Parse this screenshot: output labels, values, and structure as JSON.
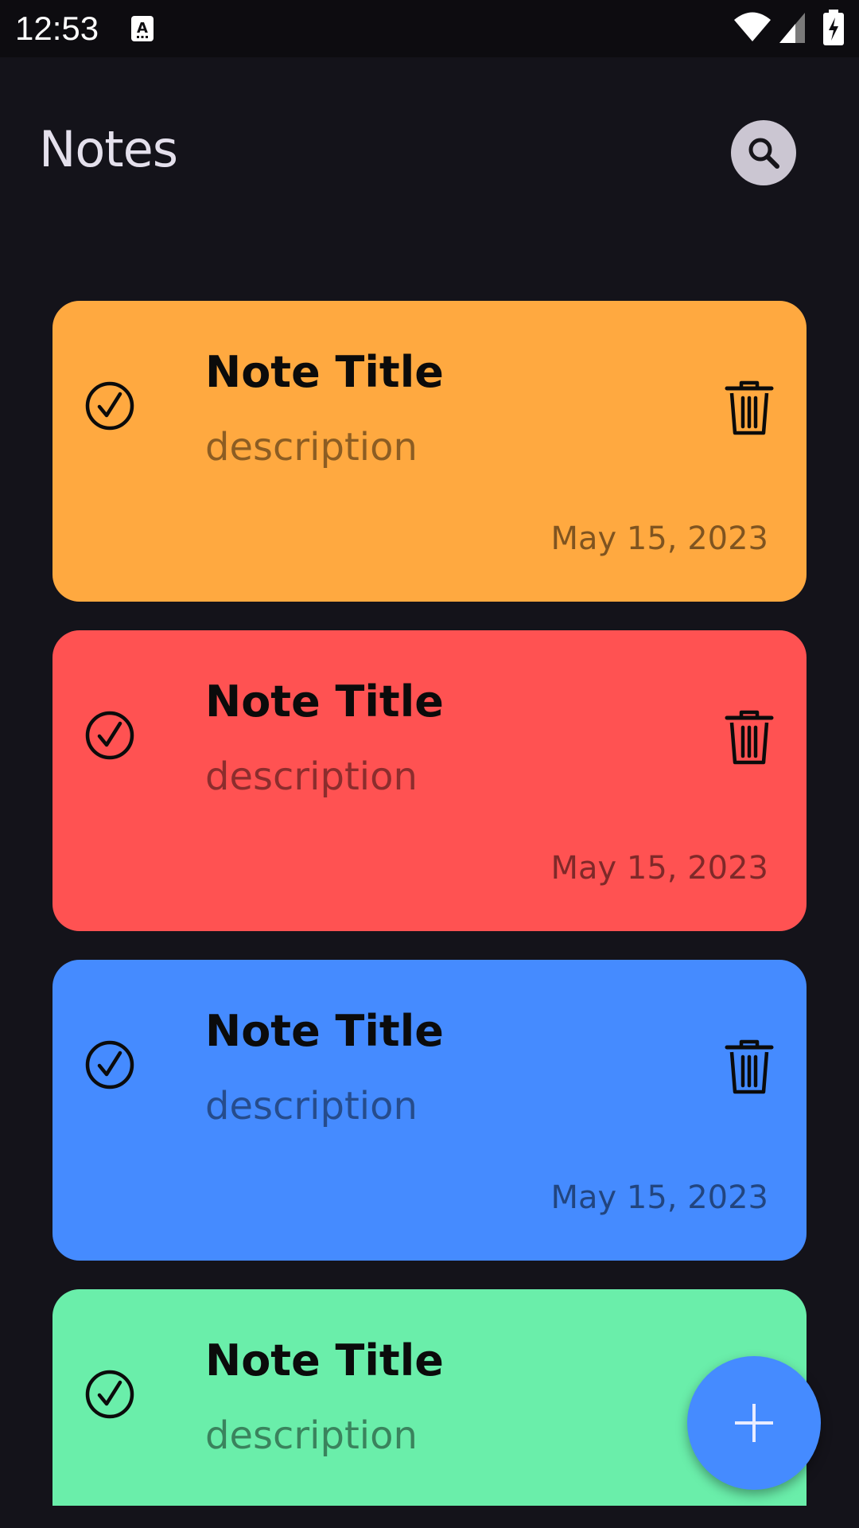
{
  "status_bar": {
    "time": "12:53",
    "icons": [
      "a-notification-icon",
      "wifi-icon",
      "signal-icon",
      "battery-charging-icon"
    ]
  },
  "header": {
    "title": "Notes",
    "search_icon": "search-icon"
  },
  "notes": [
    {
      "title": "Note Title",
      "description": "description",
      "date": "May 15, 2023",
      "color": "#ffa940"
    },
    {
      "title": "Note Title",
      "description": "description",
      "date": "May 15, 2023",
      "color": "#ff5252"
    },
    {
      "title": "Note Title",
      "description": "description",
      "date": "May 15, 2023",
      "color": "#458bff"
    },
    {
      "title": "Note Title",
      "description": "description",
      "date": "",
      "color": "#6aeeaa"
    }
  ],
  "fab": {
    "icon": "plus-icon",
    "color": "#458bff"
  },
  "colors": {
    "background": "#14131a",
    "search_button": "#cbc6d2"
  }
}
